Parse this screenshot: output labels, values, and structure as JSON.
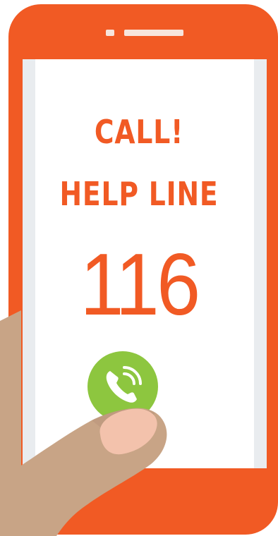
{
  "screen": {
    "line1": "CALL!",
    "line2": "HELP LINE",
    "number": "116"
  },
  "call_button": {
    "icon": "phone-ringing-icon"
  },
  "colors": {
    "phone_body": "#f15a24",
    "text": "#f15a24",
    "call_button": "#8dc63f",
    "skin": "#c8a486",
    "nail": "#f3c2ac"
  }
}
